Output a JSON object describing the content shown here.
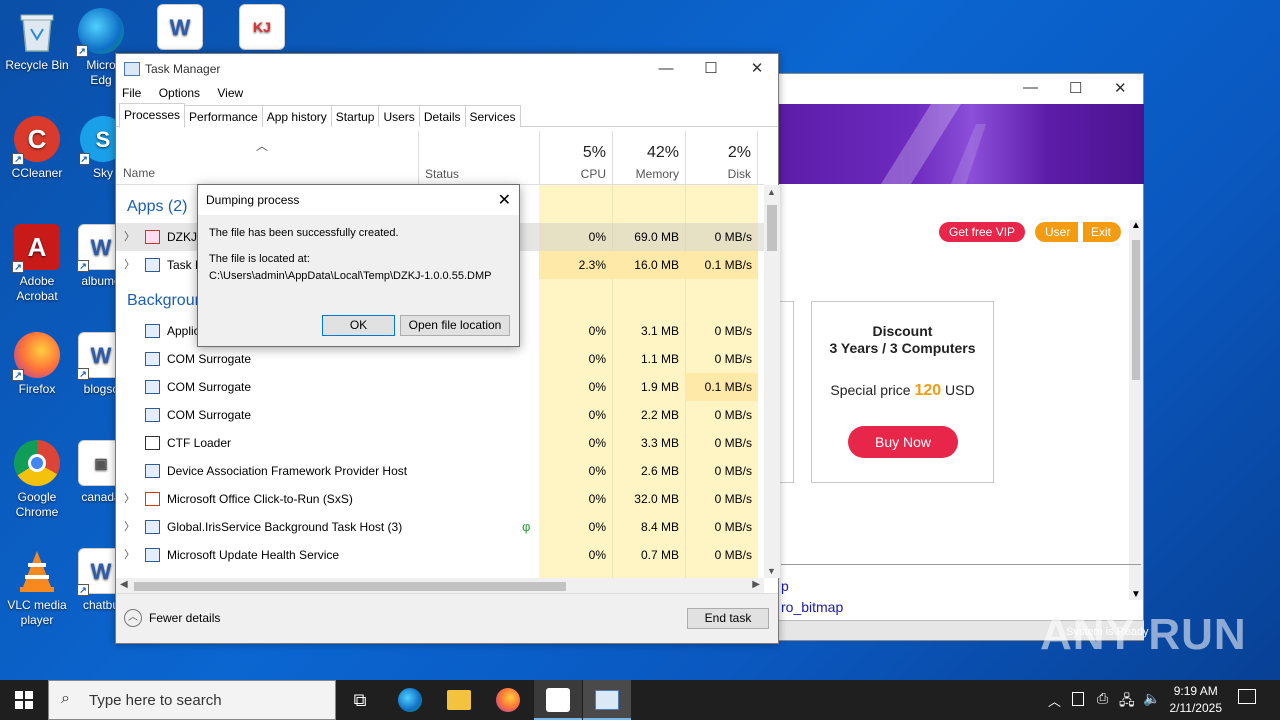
{
  "desktop": {
    "icons": [
      {
        "label": "Recycle Bin",
        "icon": "recycle-bin-icon"
      },
      {
        "label": "Micro Edg",
        "icon": "edge-icon"
      },
      {
        "label": "CCleaner",
        "icon": "ccleaner-icon"
      },
      {
        "label": "Sky",
        "icon": "skype-icon"
      },
      {
        "label": "Adobe Acrobat",
        "icon": "acrobat-icon"
      },
      {
        "label": "albumo",
        "icon": "word-doc-icon"
      },
      {
        "label": "Firefox",
        "icon": "firefox-icon"
      },
      {
        "label": "blogsc",
        "icon": "word-doc-icon"
      },
      {
        "label": "Google Chrome",
        "icon": "chrome-icon"
      },
      {
        "label": "canada",
        "icon": "image-file-icon"
      },
      {
        "label": "VLC media player",
        "icon": "vlc-icon"
      },
      {
        "label": "chatbu",
        "icon": "word-doc-icon"
      }
    ]
  },
  "background_window": {
    "vip_button": "Get free VIP",
    "user_button": "User",
    "exit_button": "Exit",
    "card_title_line1": "Discount",
    "card_title_line2": "3 Years / 3 Computers",
    "special_price_label": "Special price",
    "special_price_value": "120",
    "special_price_currency": "USD",
    "buy_now": "Buy Now",
    "link1": "p",
    "link2": "ro_bitmap"
  },
  "task_manager": {
    "title": "Task Manager",
    "menu": [
      "File",
      "Options",
      "View"
    ],
    "tabs": [
      "Processes",
      "Performance",
      "App history",
      "Startup",
      "Users",
      "Details",
      "Services"
    ],
    "columns": {
      "name": "Name",
      "status": "Status",
      "cpu_pct": "5%",
      "cpu": "CPU",
      "mem_pct": "42%",
      "mem": "Memory",
      "disk_pct": "2%",
      "disk": "Disk"
    },
    "sections": {
      "apps": "Apps (2)",
      "background": "Background"
    },
    "rows": [
      {
        "name": "DZKJ",
        "cpu": "0%",
        "mem": "69.0 MB",
        "disk": "0 MB/s",
        "exp": true
      },
      {
        "name": "Task M",
        "cpu": "2.3%",
        "mem": "16.0 MB",
        "disk": "0.1 MB/s",
        "exp": true
      },
      {
        "name": "Applic",
        "cpu": "0%",
        "mem": "3.1 MB",
        "disk": "0 MB/s",
        "exp": false
      },
      {
        "name": "COM Surrogate",
        "cpu": "0%",
        "mem": "1.1 MB",
        "disk": "0 MB/s",
        "exp": false
      },
      {
        "name": "COM Surrogate",
        "cpu": "0%",
        "mem": "1.9 MB",
        "disk": "0.1 MB/s",
        "exp": false
      },
      {
        "name": "COM Surrogate",
        "cpu": "0%",
        "mem": "2.2 MB",
        "disk": "0 MB/s",
        "exp": false
      },
      {
        "name": "CTF Loader",
        "cpu": "0%",
        "mem": "3.3 MB",
        "disk": "0 MB/s",
        "exp": false
      },
      {
        "name": "Device Association Framework Provider Host",
        "cpu": "0%",
        "mem": "2.6 MB",
        "disk": "0 MB/s",
        "exp": false
      },
      {
        "name": "Microsoft Office Click-to-Run (SxS)",
        "cpu": "0%",
        "mem": "32.0 MB",
        "disk": "0 MB/s",
        "exp": true
      },
      {
        "name": "Global.IrisService Background Task Host (3)",
        "cpu": "0%",
        "mem": "8.4 MB",
        "disk": "0 MB/s",
        "exp": true
      },
      {
        "name": "Microsoft Update Health Service",
        "cpu": "0%",
        "mem": "0.7 MB",
        "disk": "0 MB/s",
        "exp": true
      }
    ],
    "fewer_details": "Fewer details",
    "end_task": "End task"
  },
  "dialog": {
    "title": "Dumping process",
    "message1": "The file has been successfully created.",
    "message2": "The file is located at:",
    "path": "C:\\Users\\admin\\AppData\\Local\\Temp\\DZKJ-1.0.0.55.DMP",
    "ok": "OK",
    "open_location": "Open file location"
  },
  "taskbar": {
    "search_placeholder": "Type here to search",
    "time": "9:19 AM",
    "date": "2/11/2025"
  },
  "overlay": {
    "watermark": "ANY RUN",
    "system_status": "System is Ready"
  },
  "colors": {
    "accent": "#1a5fb4",
    "highlight_cell": "#fff4c4",
    "highlight_cell_strong": "#ffe9a8",
    "buy_red": "#e8264a",
    "user_orange": "#f39c12"
  }
}
